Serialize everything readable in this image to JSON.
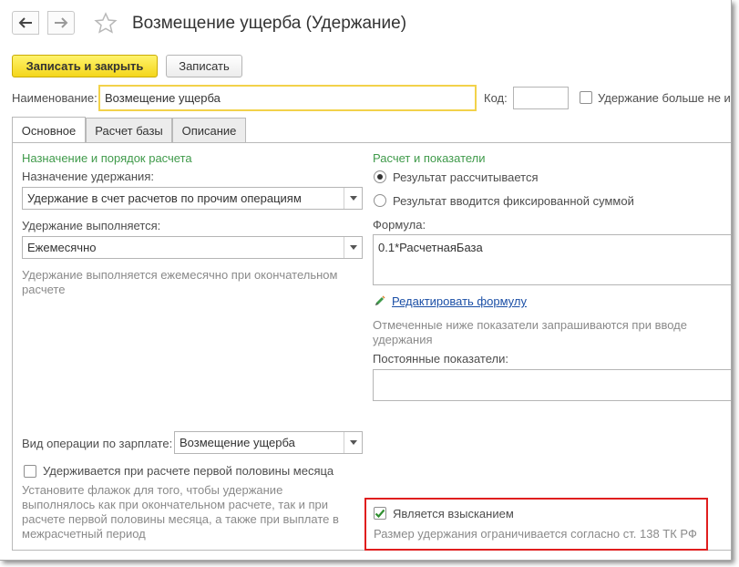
{
  "window": {
    "title": "Возмещение ущерба (Удержание)"
  },
  "toolbar": {
    "save_close_label": "Записать и закрыть",
    "save_label": "Записать"
  },
  "header": {
    "name_label": "Наименование:",
    "name_value": "Возмещение ущерба",
    "code_label": "Код:",
    "code_value": "",
    "checkbox_label": "Удержание больше не и"
  },
  "tabs": [
    {
      "label": "Основное",
      "active": true
    },
    {
      "label": "Расчет базы",
      "active": false
    },
    {
      "label": "Описание",
      "active": false
    }
  ],
  "left": {
    "group_title": "Назначение и порядок расчета",
    "purpose_label": "Назначение удержания:",
    "purpose_value": "Удержание в счет расчетов по прочим операциям",
    "performed_label": "Удержание выполняется:",
    "performed_value": "Ежемесячно",
    "performed_hint": "Удержание выполняется ежемесячно при окончательном расчете",
    "operation_label": "Вид операции по зарплате:",
    "operation_value": "Возмещение ущерба",
    "first_half_label": "Удерживается при расчете первой половины месяца",
    "first_half_hint": "Установите флажок для того, чтобы удержание выполнялось как при окончательном расчете, так и при расчете первой половины месяца, а также при выплате в межрасчетный период"
  },
  "right": {
    "group_title": "Расчет и показатели",
    "radio_calculated": "Результат рассчитывается",
    "radio_fixed": "Результат вводится фиксированной суммой",
    "formula_label": "Формула:",
    "formula_value": "0.1*РасчетнаяБаза",
    "edit_formula_link": "Редактировать формулу",
    "indicators_hint": "Отмеченные ниже показатели запрашиваются при вводе удержания",
    "constant_label": "Постоянные показатели:",
    "recovery_label": "Является взысканием",
    "recovery_hint": "Размер удержания ограничивается согласно ст. 138 ТК РФ"
  },
  "colors": {
    "primary_button": "#f4d61b",
    "group_title": "#3f9a4a",
    "link": "#1b4fa6",
    "highlight_box": "#e01e1e",
    "checkmark": "#2f8f2f"
  }
}
